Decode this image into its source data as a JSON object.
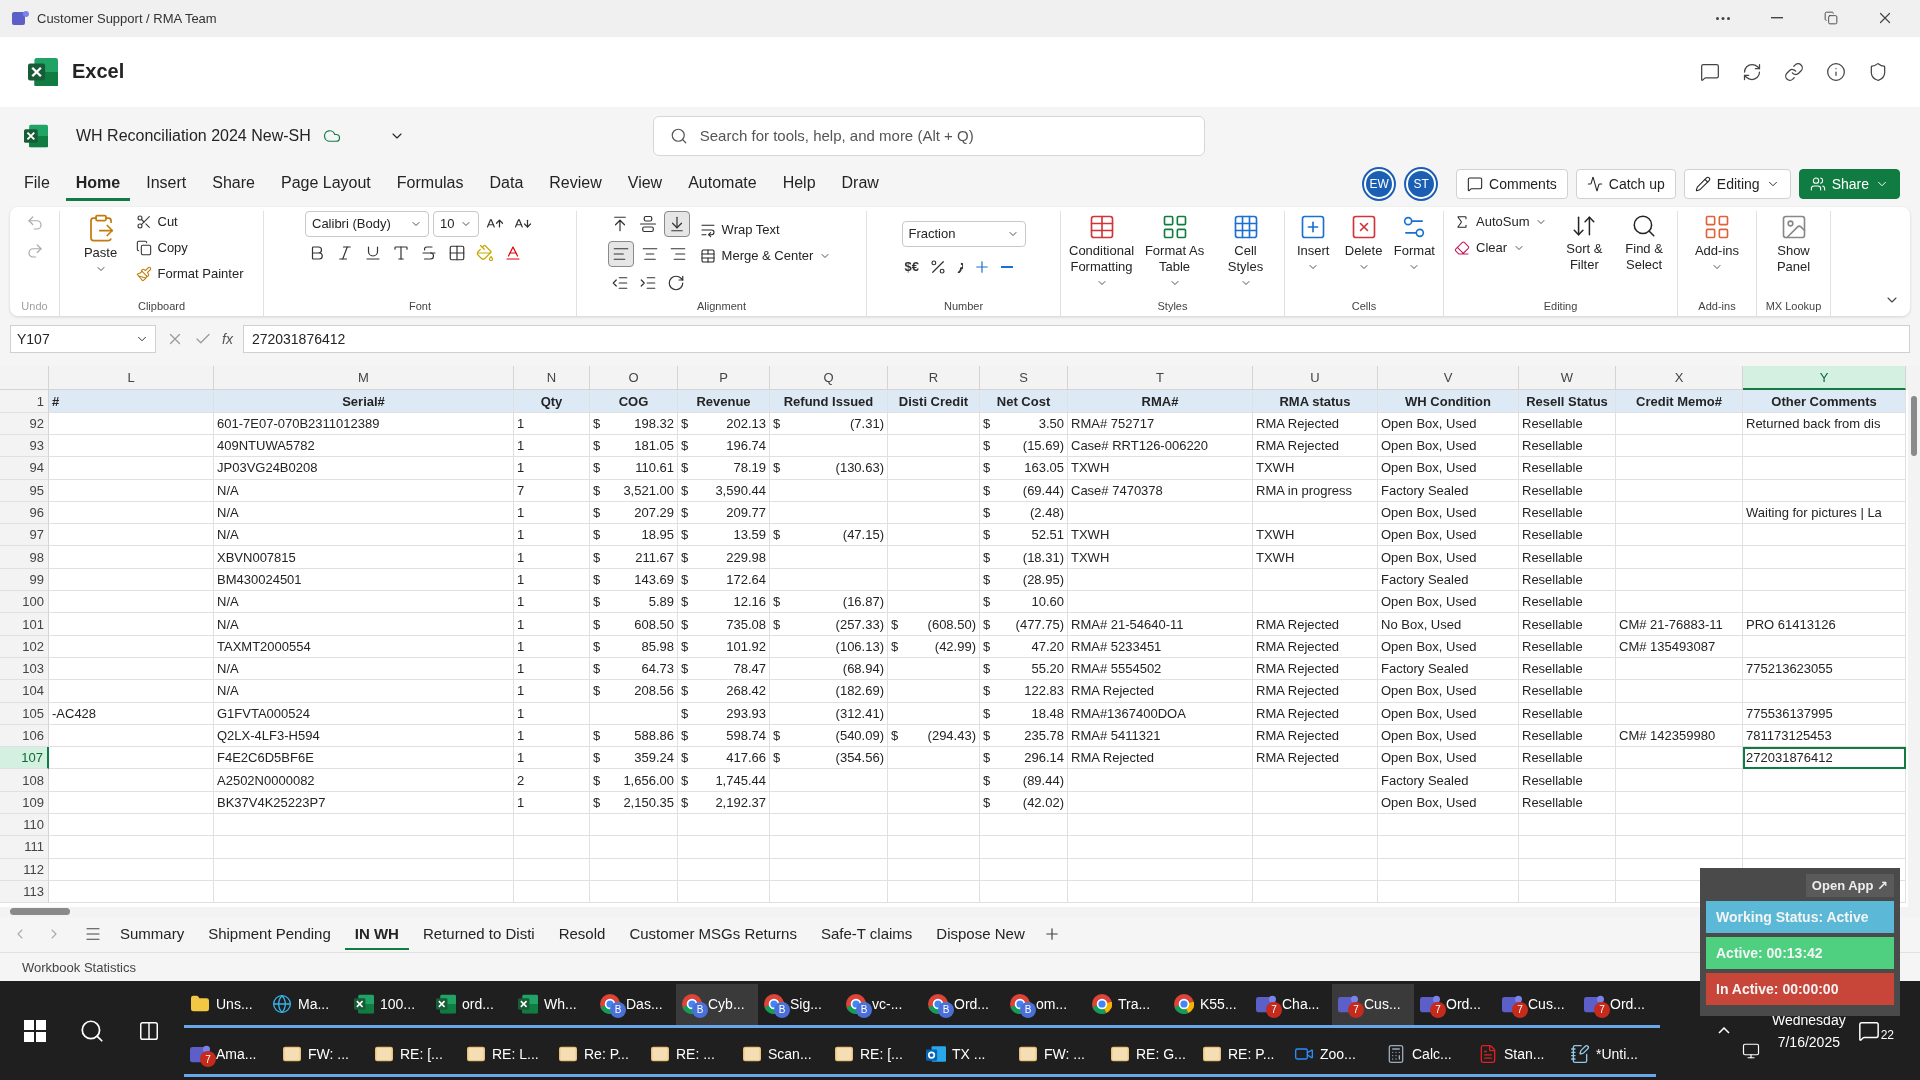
{
  "window": {
    "title": "Customer Support / RMA Team"
  },
  "app": {
    "name": "Excel"
  },
  "document": {
    "name": "WH Reconciliation 2024 New-SH"
  },
  "search": {
    "placeholder": "Search for tools, help, and more (Alt + Q)"
  },
  "menu_tabs": [
    {
      "label": "File",
      "selected": false
    },
    {
      "label": "Home",
      "selected": true
    },
    {
      "label": "Insert",
      "selected": false
    },
    {
      "label": "Share",
      "selected": false
    },
    {
      "label": "Page Layout",
      "selected": false
    },
    {
      "label": "Formulas",
      "selected": false
    },
    {
      "label": "Data",
      "selected": false
    },
    {
      "label": "Review",
      "selected": false
    },
    {
      "label": "View",
      "selected": false
    },
    {
      "label": "Automate",
      "selected": false
    },
    {
      "label": "Help",
      "selected": false
    },
    {
      "label": "Draw",
      "selected": false
    }
  ],
  "collaborators": [
    {
      "initials": "EW"
    },
    {
      "initials": "ST"
    }
  ],
  "header_buttons": [
    {
      "kind": "comments",
      "label": "Comments"
    },
    {
      "kind": "catchup",
      "label": "Catch up"
    },
    {
      "kind": "editing",
      "label": "Editing"
    },
    {
      "kind": "share",
      "label": "Share"
    }
  ],
  "ribbon": [
    {
      "kind": "undo",
      "label": "Undo"
    },
    {
      "kind": "clipboard",
      "label": "Clipboard",
      "large": "Paste",
      "small": [
        "Cut",
        "Copy",
        "Format Painter"
      ]
    },
    {
      "kind": "font",
      "label": "Font",
      "font": "Calibri (Body)",
      "size": "10"
    },
    {
      "kind": "alignment",
      "label": "Alignment",
      "small": [
        "Wrap Text",
        "Merge & Center"
      ]
    },
    {
      "kind": "number",
      "label": "Number",
      "format": "Fraction",
      "currency": "$€"
    },
    {
      "kind": "large",
      "label": "Styles",
      "buttons": [
        "Conditional Formatting",
        "Format As Table",
        "Cell Styles"
      ]
    },
    {
      "kind": "large",
      "label": "Cells",
      "buttons": [
        "Insert",
        "Delete",
        "Format"
      ]
    },
    {
      "kind": "editing",
      "label": "Editing",
      "small": [
        "AutoSum",
        "Clear"
      ],
      "buttons": [
        "Sort & Filter",
        "Find & Select"
      ]
    },
    {
      "kind": "large",
      "label": "Add-ins",
      "buttons": [
        "Add-ins"
      ]
    },
    {
      "kind": "large",
      "label": "MX Lookup",
      "buttons": [
        "Show Panel"
      ]
    }
  ],
  "formula_bar": {
    "name_box": "Y107",
    "fx_label": "fx",
    "formula": "272031876412"
  },
  "sheet": {
    "columns": [
      {
        "letter": "L",
        "heading": "#",
        "selected": false
      },
      {
        "letter": "M",
        "heading": "Serial#",
        "selected": false
      },
      {
        "letter": "N",
        "heading": "Qty",
        "selected": false
      },
      {
        "letter": "O",
        "heading": "COG",
        "selected": false
      },
      {
        "letter": "P",
        "heading": "Revenue",
        "selected": false
      },
      {
        "letter": "Q",
        "heading": "Refund Issued",
        "selected": false
      },
      {
        "letter": "R",
        "heading": "Disti Credit",
        "selected": false
      },
      {
        "letter": "S",
        "heading": "Net Cost",
        "selected": false
      },
      {
        "letter": "T",
        "heading": "RMA#",
        "selected": false
      },
      {
        "letter": "U",
        "heading": "RMA status",
        "selected": false
      },
      {
        "letter": "V",
        "heading": "WH Condition",
        "selected": false
      },
      {
        "letter": "W",
        "heading": "Resell Status",
        "selected": false
      },
      {
        "letter": "X",
        "heading": "Credit Memo#",
        "selected": false
      },
      {
        "letter": "Y",
        "heading": "Other Comments",
        "selected": true
      }
    ],
    "header_row": "1",
    "rows": [
      {
        "num": "92",
        "selected": false,
        "cells": [
          null,
          "601-7E07-070B2311012389",
          "1",
          {
            "symbol": "$",
            "amount": "198.32"
          },
          {
            "symbol": "$",
            "amount": "202.13"
          },
          {
            "symbol": "$",
            "amount": "(7.31)"
          },
          null,
          {
            "symbol": "$",
            "amount": "3.50"
          },
          "RMA# 752717",
          "RMA Rejected",
          "Open Box, Used",
          "Resellable",
          null,
          "Returned back from dis"
        ]
      },
      {
        "num": "93",
        "selected": false,
        "cells": [
          null,
          "409NTUWA5782",
          "1",
          {
            "symbol": "$",
            "amount": "181.05"
          },
          {
            "symbol": "$",
            "amount": "196.74"
          },
          null,
          null,
          {
            "symbol": "$",
            "amount": "(15.69)"
          },
          "Case# RRT126-006220",
          "RMA Rejected",
          "Open Box, Used",
          "Resellable",
          null,
          null
        ]
      },
      {
        "num": "94",
        "selected": false,
        "cells": [
          null,
          "JP03VG24B0208",
          "1",
          {
            "symbol": "$",
            "amount": "110.61"
          },
          {
            "symbol": "$",
            "amount": "78.19"
          },
          {
            "symbol": "$",
            "amount": "(130.63)"
          },
          null,
          {
            "symbol": "$",
            "amount": "163.05"
          },
          "TXWH",
          "TXWH",
          "Open Box, Used",
          "Resellable",
          null,
          null
        ]
      },
      {
        "num": "95",
        "selected": false,
        "cells": [
          null,
          "N/A",
          "7",
          {
            "symbol": "$",
            "amount": "3,521.00"
          },
          {
            "symbol": "$",
            "amount": "3,590.44"
          },
          null,
          null,
          {
            "symbol": "$",
            "amount": "(69.44)"
          },
          "Case# 7470378",
          "RMA in progress",
          "Factory Sealed",
          "Resellable",
          null,
          null
        ]
      },
      {
        "num": "96",
        "selected": false,
        "cells": [
          null,
          "N/A",
          "1",
          {
            "symbol": "$",
            "amount": "207.29"
          },
          {
            "symbol": "$",
            "amount": "209.77"
          },
          null,
          null,
          {
            "symbol": "$",
            "amount": "(2.48)"
          },
          null,
          null,
          "Open Box, Used",
          "Resellable",
          null,
          "Waiting for pictures | La"
        ]
      },
      {
        "num": "97",
        "selected": false,
        "cells": [
          null,
          "N/A",
          "1",
          {
            "symbol": "$",
            "amount": "18.95"
          },
          {
            "symbol": "$",
            "amount": "13.59"
          },
          {
            "symbol": "$",
            "amount": "(47.15)"
          },
          null,
          {
            "symbol": "$",
            "amount": "52.51"
          },
          "TXWH",
          "TXWH",
          "Open Box, Used",
          "Resellable",
          null,
          null
        ]
      },
      {
        "num": "98",
        "selected": false,
        "cells": [
          null,
          "XBVN007815",
          "1",
          {
            "symbol": "$",
            "amount": "211.67"
          },
          {
            "symbol": "$",
            "amount": "229.98"
          },
          null,
          null,
          {
            "symbol": "$",
            "amount": "(18.31)"
          },
          "TXWH",
          "TXWH",
          "Open Box, Used",
          "Resellable",
          null,
          null
        ]
      },
      {
        "num": "99",
        "selected": false,
        "cells": [
          null,
          "BM430024501",
          "1",
          {
            "symbol": "$",
            "amount": "143.69"
          },
          {
            "symbol": "$",
            "amount": "172.64"
          },
          null,
          null,
          {
            "symbol": "$",
            "amount": "(28.95)"
          },
          null,
          null,
          "Factory Sealed",
          "Resellable",
          null,
          null
        ]
      },
      {
        "num": "100",
        "selected": false,
        "cells": [
          null,
          "N/A",
          "1",
          {
            "symbol": "$",
            "amount": "5.89"
          },
          {
            "symbol": "$",
            "amount": "12.16"
          },
          {
            "symbol": "$",
            "amount": "(16.87)"
          },
          null,
          {
            "symbol": "$",
            "amount": "10.60"
          },
          null,
          null,
          "Open Box, Used",
          "Resellable",
          null,
          null
        ]
      },
      {
        "num": "101",
        "selected": false,
        "cells": [
          null,
          "N/A",
          "1",
          {
            "symbol": "$",
            "amount": "608.50"
          },
          {
            "symbol": "$",
            "amount": "735.08"
          },
          {
            "symbol": "$",
            "amount": "(257.33)"
          },
          {
            "symbol": "$",
            "amount": "(608.50)"
          },
          {
            "symbol": "$",
            "amount": "(477.75)"
          },
          "RMA# 21-54640-11",
          "RMA Rejected",
          "No Box, Used",
          "Resellable",
          "CM# 21-76883-11",
          "PRO 61413126"
        ]
      },
      {
        "num": "102",
        "selected": false,
        "cells": [
          null,
          "TAXMT2000554",
          "1",
          {
            "symbol": "$",
            "amount": "85.98"
          },
          {
            "symbol": "$",
            "amount": "101.92"
          },
          {
            "amount": "(106.13)"
          },
          {
            "symbol": "$",
            "amount": "(42.99)"
          },
          {
            "symbol": "$",
            "amount": "47.20"
          },
          "RMA# 5233451",
          "RMA Rejected",
          "Open Box, Used",
          "Resellable",
          "CM# 135493087",
          null
        ]
      },
      {
        "num": "103",
        "selected": false,
        "cells": [
          null,
          "N/A",
          "1",
          {
            "symbol": "$",
            "amount": "64.73"
          },
          {
            "symbol": "$",
            "amount": "78.47"
          },
          {
            "amount": "(68.94)"
          },
          null,
          {
            "symbol": "$",
            "amount": "55.20"
          },
          "RMA# 5554502",
          "RMA Rejected",
          "Factory Sealed",
          "Resellable",
          null,
          "775213623055"
        ]
      },
      {
        "num": "104",
        "selected": false,
        "cells": [
          null,
          "N/A",
          "1",
          {
            "symbol": "$",
            "amount": "208.56"
          },
          {
            "symbol": "$",
            "amount": "268.42"
          },
          {
            "amount": "(182.69)"
          },
          null,
          {
            "symbol": "$",
            "amount": "122.83"
          },
          "RMA Rejected",
          "RMA Rejected",
          "Open Box, Used",
          "Resellable",
          null,
          null
        ]
      },
      {
        "num": "105",
        "selected": false,
        "cells": [
          "-AC428",
          "G1FVTA000524",
          "1",
          null,
          {
            "symbol": "$",
            "amount": "293.93"
          },
          {
            "amount": "(312.41)"
          },
          null,
          {
            "symbol": "$",
            "amount": "18.48"
          },
          "RMA#1367400DOA",
          "RMA Rejected",
          "Open Box, Used",
          "Resellable",
          null,
          "775536137995"
        ]
      },
      {
        "num": "106",
        "selected": false,
        "cells": [
          null,
          "Q2LX-4LF3-H594",
          "1",
          {
            "symbol": "$",
            "amount": "588.86"
          },
          {
            "symbol": "$",
            "amount": "598.74"
          },
          {
            "symbol": "$",
            "amount": "(540.09)"
          },
          {
            "symbol": "$",
            "amount": "(294.43)"
          },
          {
            "symbol": "$",
            "amount": "235.78"
          },
          "RMA# 5411321",
          "RMA Rejected",
          "Open Box, Used",
          "Resellable",
          "CM# 142359980",
          "781173125453"
        ]
      },
      {
        "num": "107",
        "selected": true,
        "cells": [
          null,
          "F4E2C6D5BF6E",
          "1",
          {
            "symbol": "$",
            "amount": "359.24"
          },
          {
            "symbol": "$",
            "amount": "417.66"
          },
          {
            "symbol": "$",
            "amount": "(354.56)"
          },
          null,
          {
            "symbol": "$",
            "amount": "296.14"
          },
          "RMA Rejected",
          "RMA Rejected",
          "Open Box, Used",
          "Resellable",
          null,
          "272031876412"
        ]
      },
      {
        "num": "108",
        "selected": false,
        "cells": [
          null,
          "A2502N0000082",
          "2",
          {
            "symbol": "$",
            "amount": "1,656.00"
          },
          {
            "symbol": "$",
            "amount": "1,745.44"
          },
          null,
          null,
          {
            "symbol": "$",
            "amount": "(89.44)"
          },
          null,
          null,
          "Factory Sealed",
          "Resellable",
          null,
          null
        ]
      },
      {
        "num": "109",
        "selected": false,
        "cells": [
          null,
          "BK37V4K25223P7",
          "1",
          {
            "symbol": "$",
            "amount": "2,150.35"
          },
          {
            "symbol": "$",
            "amount": "2,192.37"
          },
          null,
          null,
          {
            "symbol": "$",
            "amount": "(42.02)"
          },
          null,
          null,
          "Open Box, Used",
          "Resellable",
          null,
          null
        ]
      },
      {
        "num": "110",
        "selected": false,
        "cells": []
      },
      {
        "num": "111",
        "selected": false,
        "cells": []
      },
      {
        "num": "112",
        "selected": false,
        "cells": []
      },
      {
        "num": "113",
        "selected": false,
        "cells": []
      }
    ]
  },
  "sheet_tabs": [
    {
      "label": "Summary",
      "selected": false
    },
    {
      "label": "Shipment Pending",
      "selected": false
    },
    {
      "label": "IN WH",
      "selected": true
    },
    {
      "label": "Returned to Disti",
      "selected": false
    },
    {
      "label": "Resold",
      "selected": false
    },
    {
      "label": "Customer MSGs Returns",
      "selected": false
    },
    {
      "label": "Safe-T claims",
      "selected": false
    },
    {
      "label": "Dispose New",
      "selected": false
    }
  ],
  "status_bar": {
    "text": "Workbook Statistics"
  },
  "status_widget": {
    "open_app": "Open App ↗",
    "lines": [
      {
        "text": "Working Status: Active",
        "color": "#5bb8d6"
      },
      {
        "text": "Active: 00:13:42",
        "color": "#4fcf80"
      },
      {
        "text": "In Active: 00:00:00",
        "color": "#c8453a"
      }
    ]
  },
  "taskbar": {
    "row_1": [
      {
        "kind": "folder",
        "label": "Uns...",
        "selected": false
      },
      {
        "kind": "edge",
        "label": "Ma...",
        "selected": false
      },
      {
        "kind": "excel",
        "label": "100...",
        "selected": false
      },
      {
        "kind": "excel",
        "label": "ord...",
        "selected": false
      },
      {
        "kind": "excel",
        "label": "Wh...",
        "selected": false
      },
      {
        "kind": "chrome",
        "label": "Das...",
        "badge": "B",
        "selected": false
      },
      {
        "kind": "chrome",
        "label": "Cyb...",
        "badge": "B",
        "selected": true
      },
      {
        "kind": "chrome",
        "label": "Sig...",
        "badge": "B",
        "selected": false
      },
      {
        "kind": "chrome",
        "label": "vc-...",
        "badge": "B",
        "selected": false
      },
      {
        "kind": "chrome",
        "label": "Ord...",
        "badge": "B",
        "selected": false
      },
      {
        "kind": "chrome",
        "label": "om...",
        "badge": "B",
        "selected": false
      },
      {
        "kind": "chrome",
        "label": "Tra...",
        "selected": false
      },
      {
        "kind": "chrome",
        "label": "K55...",
        "selected": false
      },
      {
        "kind": "teams",
        "label": "Cha...",
        "badge": "7",
        "selected": false
      },
      {
        "kind": "teams",
        "label": "Cus...",
        "badge": "7",
        "selected": true
      },
      {
        "kind": "teams",
        "label": "Ord...",
        "badge": "7",
        "selected": false
      },
      {
        "kind": "teams",
        "label": "Cus...",
        "badge": "7",
        "selected": false
      },
      {
        "kind": "teams",
        "label": "Ord...",
        "badge": "7",
        "selected": false
      }
    ],
    "row_2": [
      {
        "kind": "teams",
        "label": "Ama...",
        "badge": "7",
        "selected": false
      },
      {
        "kind": "mail",
        "label": "FW: ...",
        "selected": false
      },
      {
        "kind": "mail",
        "label": "RE: [...",
        "selected": false
      },
      {
        "kind": "mail",
        "label": "RE: L...",
        "selected": false
      },
      {
        "kind": "mail",
        "label": "Re: P...",
        "selected": false
      },
      {
        "kind": "mail",
        "label": "RE: ...",
        "selected": false
      },
      {
        "kind": "mail",
        "label": "Scan...",
        "selected": false
      },
      {
        "kind": "mail",
        "label": "RE: [...",
        "selected": false
      },
      {
        "kind": "outlook",
        "label": "TX ...",
        "selected": false
      },
      {
        "kind": "mail",
        "label": "FW: ...",
        "selected": false
      },
      {
        "kind": "mail",
        "label": "RE: G...",
        "selected": false
      },
      {
        "kind": "mail",
        "label": "RE: P...",
        "selected": false
      },
      {
        "kind": "zoom",
        "label": "Zoo...",
        "selected": false
      },
      {
        "kind": "calculator",
        "label": "Calc...",
        "selected": false
      },
      {
        "kind": "pdf",
        "label": "Stan...",
        "selected": false
      },
      {
        "kind": "notepad",
        "label": "*Unti...",
        "selected": false
      }
    ],
    "day": "Wednesday",
    "date": "7/16/2025",
    "notifications": "22"
  }
}
